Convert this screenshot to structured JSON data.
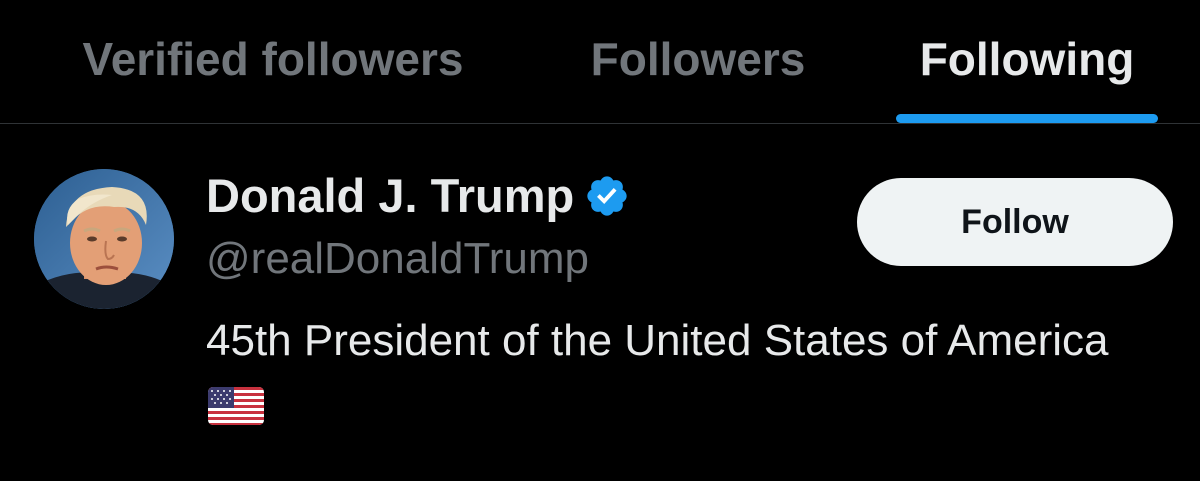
{
  "tabs": [
    {
      "label": "Verified followers",
      "active": false
    },
    {
      "label": "Followers",
      "active": false
    },
    {
      "label": "Following",
      "active": true
    }
  ],
  "accent_color": "#1d9bf0",
  "user": {
    "display_name": "Donald J. Trump",
    "verified_icon": "verified-badge-icon",
    "handle": "@realDonaldTrump",
    "bio_text": "45th President of the United States of America",
    "bio_emoji": "us-flag-icon",
    "follow_label": "Follow"
  }
}
